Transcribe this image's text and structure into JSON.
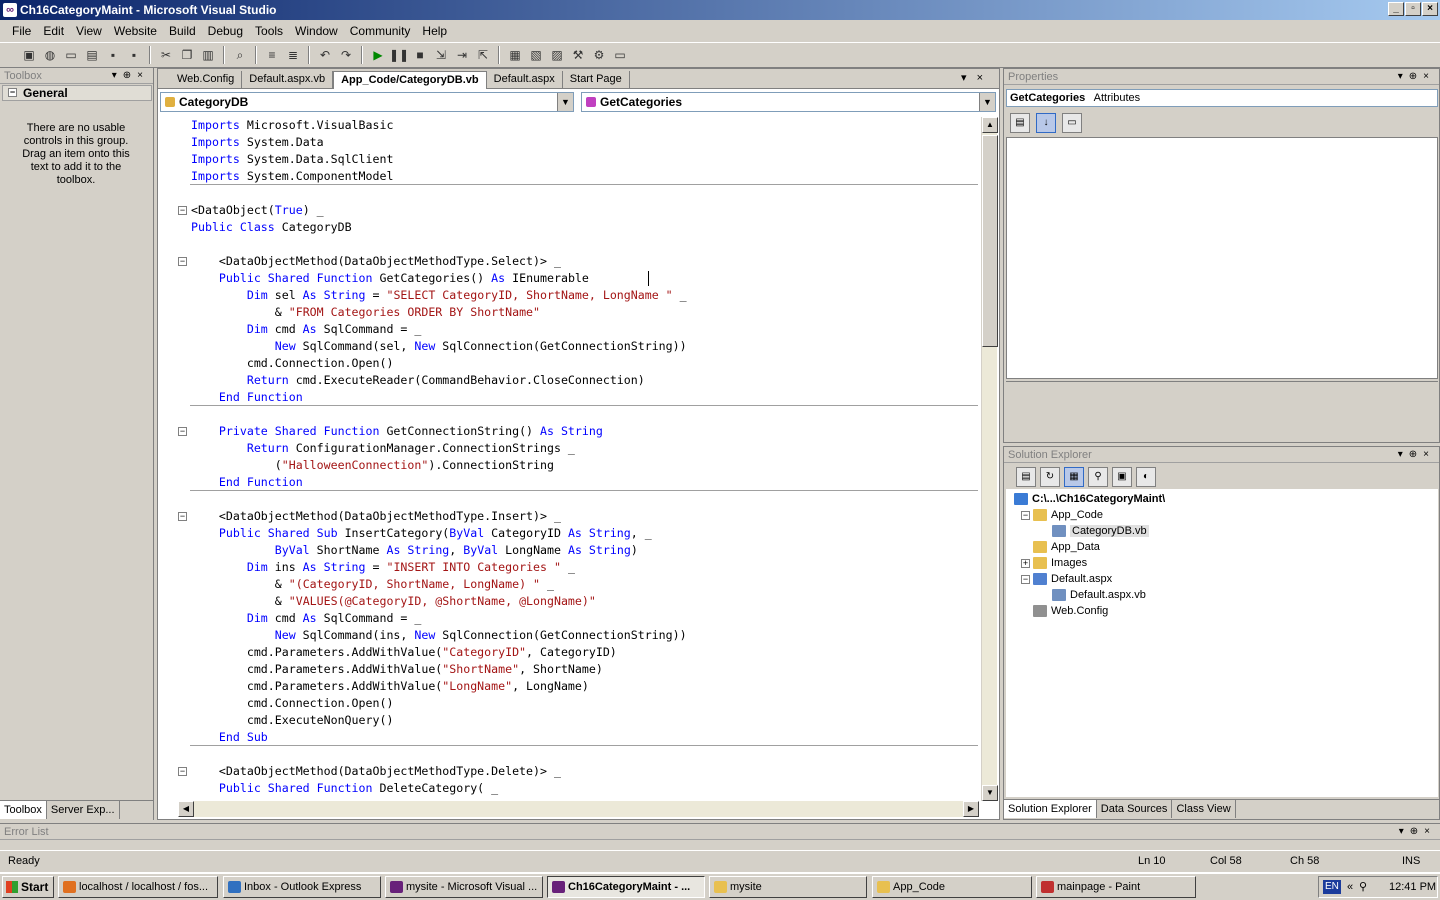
{
  "window": {
    "title": "Ch16CategoryMaint - Microsoft Visual Studio"
  },
  "menu": [
    "File",
    "Edit",
    "View",
    "Website",
    "Build",
    "Debug",
    "Tools",
    "Window",
    "Community",
    "Help"
  ],
  "toolbox": {
    "title": "Toolbox",
    "group": "General",
    "empty_message": "There are no usable controls in this group. Drag an item onto this text to add it to the toolbox.",
    "tabs": [
      "Toolbox",
      "Server Exp..."
    ]
  },
  "editor": {
    "tabs": [
      "Web.Config",
      "Default.aspx.vb",
      "App_Code/CategoryDB.vb",
      "Default.aspx",
      "Start Page"
    ],
    "active_tab": "App_Code/CategoryDB.vb",
    "class_combo": "CategoryDB",
    "member_combo": "GetCategories"
  },
  "code_lines": [
    [
      [
        "kw",
        "Imports"
      ],
      [
        "",
        "Microsoft.VisualBasic"
      ]
    ],
    [
      [
        "kw",
        "Imports"
      ],
      [
        "",
        "System.Data"
      ]
    ],
    [
      [
        "kw",
        "Imports"
      ],
      [
        "",
        "System.Data.SqlClient"
      ]
    ],
    [
      [
        "kw",
        "Imports"
      ],
      [
        "",
        "System.ComponentModel"
      ]
    ],
    [],
    [
      [
        "",
        "<DataObject("
      ],
      [
        "kw",
        "True"
      ],
      [
        "",
        ") _"
      ]
    ],
    [
      [
        "kw",
        "Public Class"
      ],
      [
        "",
        "CategoryDB"
      ]
    ],
    [],
    [
      [
        "",
        "    <DataObjectMethod(DataObjectMethodType.Select)> _"
      ]
    ],
    [
      [
        "kw",
        "    Public Shared Function"
      ],
      [
        "",
        "GetCategories()"
      ],
      [
        "kw",
        "As"
      ],
      [
        "",
        "IEnumerable"
      ]
    ],
    [
      [
        "kw",
        "        Dim"
      ],
      [
        "",
        "sel"
      ],
      [
        "kw",
        "As String"
      ],
      [
        "",
        "="
      ],
      [
        "st",
        "\"SELECT CategoryID, ShortName, LongName \""
      ],
      [
        "",
        "_"
      ]
    ],
    [
      [
        "",
        "            &"
      ],
      [
        "st",
        "\"FROM Categories ORDER BY ShortName\""
      ]
    ],
    [
      [
        "kw",
        "        Dim"
      ],
      [
        "",
        "cmd"
      ],
      [
        "kw",
        "As"
      ],
      [
        "",
        "SqlCommand = _"
      ]
    ],
    [
      [
        "kw",
        "            New"
      ],
      [
        "",
        "SqlCommand(sel,"
      ],
      [
        "kw",
        "New"
      ],
      [
        "",
        "SqlConnection(GetConnectionString))"
      ]
    ],
    [
      [
        "",
        "        cmd.Connection.Open()"
      ]
    ],
    [
      [
        "kw",
        "        Return"
      ],
      [
        "",
        "cmd.ExecuteReader(CommandBehavior.CloseConnection)"
      ]
    ],
    [
      [
        "kw",
        "    End Function"
      ]
    ],
    [],
    [
      [
        "kw",
        "    Private Shared Function"
      ],
      [
        "",
        "GetConnectionString()"
      ],
      [
        "kw",
        "As String"
      ]
    ],
    [
      [
        "kw",
        "        Return"
      ],
      [
        "",
        "ConfigurationManager.ConnectionStrings _"
      ]
    ],
    [
      [
        "",
        "            ("
      ],
      [
        "st",
        "\"HalloweenConnection\""
      ],
      [
        "",
        ").ConnectionString"
      ]
    ],
    [
      [
        "kw",
        "    End Function"
      ]
    ],
    [],
    [
      [
        "",
        "    <DataObjectMethod(DataObjectMethodType.Insert)> _"
      ]
    ],
    [
      [
        "kw",
        "    Public Shared Sub"
      ],
      [
        "",
        "InsertCategory("
      ],
      [
        "kw",
        "ByVal"
      ],
      [
        "",
        "CategoryID"
      ],
      [
        "kw",
        "As String"
      ],
      [
        "",
        ", _"
      ]
    ],
    [
      [
        "kw",
        "            ByVal"
      ],
      [
        "",
        "ShortName"
      ],
      [
        "kw",
        "As String"
      ],
      [
        "",
        ","
      ],
      [
        "kw",
        "ByVal"
      ],
      [
        "",
        "LongName"
      ],
      [
        "kw",
        "As String"
      ],
      [
        "",
        ")"
      ]
    ],
    [
      [
        "kw",
        "        Dim"
      ],
      [
        "",
        "ins"
      ],
      [
        "kw",
        "As String"
      ],
      [
        "",
        "="
      ],
      [
        "st",
        "\"INSERT INTO Categories \""
      ],
      [
        "",
        "_"
      ]
    ],
    [
      [
        "",
        "            &"
      ],
      [
        "st",
        "\"(CategoryID, ShortName, LongName) \""
      ],
      [
        "",
        "_"
      ]
    ],
    [
      [
        "",
        "            &"
      ],
      [
        "st",
        "\"VALUES(@CategoryID, @ShortName, @LongName)\""
      ]
    ],
    [
      [
        "kw",
        "        Dim"
      ],
      [
        "",
        "cmd"
      ],
      [
        "kw",
        "As"
      ],
      [
        "",
        "SqlCommand = _"
      ]
    ],
    [
      [
        "kw",
        "            New"
      ],
      [
        "",
        "SqlCommand(ins,"
      ],
      [
        "kw",
        "New"
      ],
      [
        "",
        "SqlConnection(GetConnectionString))"
      ]
    ],
    [
      [
        "",
        "        cmd.Parameters.AddWithValue("
      ],
      [
        "st",
        "\"CategoryID\""
      ],
      [
        "",
        ", CategoryID)"
      ]
    ],
    [
      [
        "",
        "        cmd.Parameters.AddWithValue("
      ],
      [
        "st",
        "\"ShortName\""
      ],
      [
        "",
        ", ShortName)"
      ]
    ],
    [
      [
        "",
        "        cmd.Parameters.AddWithValue("
      ],
      [
        "st",
        "\"LongName\""
      ],
      [
        "",
        ", LongName)"
      ]
    ],
    [
      [
        "",
        "        cmd.Connection.Open()"
      ]
    ],
    [
      [
        "",
        "        cmd.ExecuteNonQuery()"
      ]
    ],
    [
      [
        "kw",
        "    End Sub"
      ]
    ],
    [],
    [
      [
        "",
        "    <DataObjectMethod(DataObjectMethodType.Delete)> _"
      ]
    ],
    [
      [
        "kw",
        "    Public Shared Function"
      ],
      [
        "",
        "DeleteCategory( _"
      ]
    ]
  ],
  "properties": {
    "title": "Properties",
    "object": "GetCategories",
    "object_type": "Attributes"
  },
  "solution_explorer": {
    "title": "Solution Explorer",
    "items": [
      {
        "label": "C:\\...\\Ch16CategoryMaint\\",
        "depth": 0,
        "expander": "",
        "bold": true,
        "icon": "web-project-icon"
      },
      {
        "label": "App_Code",
        "depth": 1,
        "expander": "−",
        "icon": "folder-icon"
      },
      {
        "label": "CategoryDB.vb",
        "depth": 2,
        "expander": "",
        "selected": true,
        "icon": "vb-file-icon"
      },
      {
        "label": "App_Data",
        "depth": 1,
        "expander": "",
        "icon": "folder-icon"
      },
      {
        "label": "Images",
        "depth": 1,
        "expander": "+",
        "icon": "folder-icon"
      },
      {
        "label": "Default.aspx",
        "depth": 1,
        "expander": "−",
        "icon": "aspx-file-icon"
      },
      {
        "label": "Default.aspx.vb",
        "depth": 2,
        "expander": "",
        "icon": "vb-file-icon"
      },
      {
        "label": "Web.Config",
        "depth": 1,
        "expander": "",
        "icon": "config-file-icon"
      }
    ],
    "tabs": [
      "Solution Explorer",
      "Data Sources",
      "Class View"
    ]
  },
  "error_list": {
    "title": "Error List"
  },
  "status": {
    "ready": "Ready",
    "line": "Ln 10",
    "col": "Col 58",
    "ch": "Ch 58",
    "mode": "INS"
  },
  "taskbar": {
    "start": "Start",
    "tasks": [
      "localhost / localhost / fos...",
      "Inbox - Outlook Express",
      "mysite - Microsoft Visual ...",
      "Ch16CategoryMaint - ...",
      "mysite",
      "App_Code",
      "mainpage - Paint"
    ],
    "active_task": "Ch16CategoryMaint - ...",
    "lang": "EN",
    "time": "12:41 PM"
  },
  "colors": {
    "keyword": "#0000ff",
    "string": "#a31515",
    "title_start": "#0a246a",
    "title_end": "#a6caf0"
  }
}
